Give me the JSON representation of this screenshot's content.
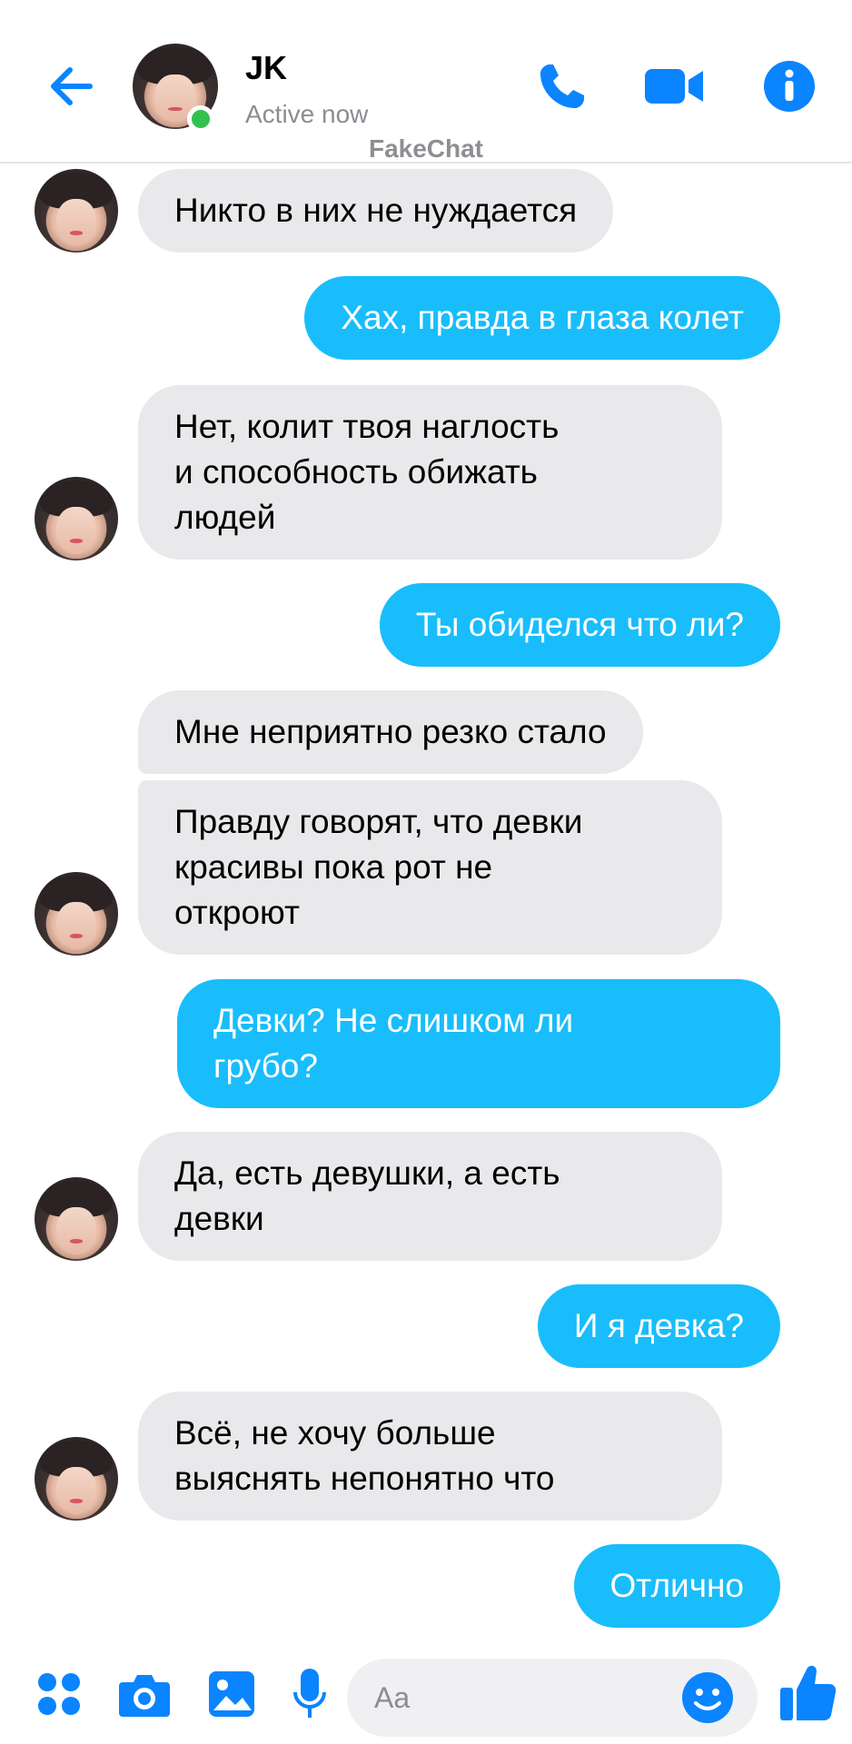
{
  "header": {
    "contact_name": "JK",
    "status": "Active now",
    "watermark": "FakeChat",
    "icons": [
      "back-arrow-icon",
      "phone-icon",
      "video-camera-icon",
      "info-icon"
    ]
  },
  "messages": [
    {
      "side": "in",
      "text": "Никто в них не нуждается"
    },
    {
      "side": "out",
      "text": "Хах, правда в глаза колет"
    },
    {
      "side": "in",
      "text": "Нет, колит твоя наглость\nи способность обижать\nлюдей"
    },
    {
      "side": "out",
      "text": "Ты обиделся что ли?"
    },
    {
      "side": "in",
      "text": "Мне неприятно резко стало"
    },
    {
      "side": "in",
      "text": "Правду говорят, что девки\nкрасивы пока рот не\nоткроют"
    },
    {
      "side": "out",
      "text": "Девки? Не слишком ли\nгрубо?"
    },
    {
      "side": "in",
      "text": "Да, есть девушки, а есть\nдевки"
    },
    {
      "side": "out",
      "text": "И я девка?"
    },
    {
      "side": "in",
      "text": "Всё, не хочу больше\nвыяснять непонятно что"
    },
    {
      "side": "out",
      "text": "Отлично"
    }
  ],
  "composer": {
    "placeholder": "Aa",
    "icons": [
      "menu-dots-icon",
      "camera-icon",
      "gallery-icon",
      "microphone-icon",
      "emoji-icon",
      "thumbs-up-icon"
    ]
  },
  "colors": {
    "accent": "#0a84ff",
    "outgoing_bubble": "#19bdfb",
    "incoming_bubble": "#e9e9eb",
    "active_dot": "#31c24d"
  }
}
